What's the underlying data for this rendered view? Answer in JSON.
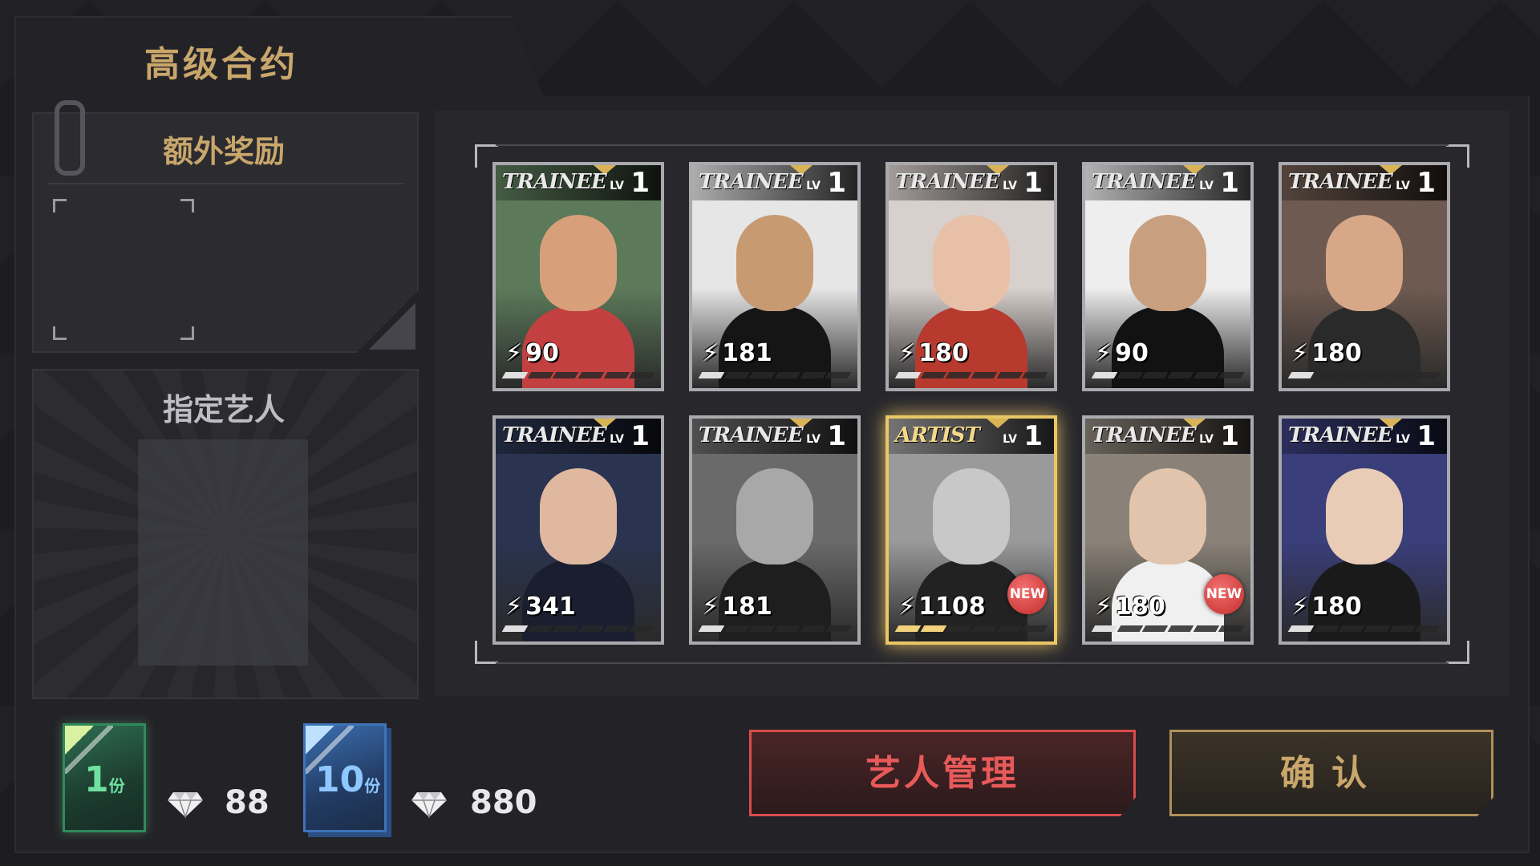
{
  "title": "高级合约",
  "bonus_panel": {
    "title": "额外奖励"
  },
  "artist_panel": {
    "title": "指定艺人"
  },
  "cards": [
    {
      "brand": "TRAINEE",
      "lv_label": "LV",
      "level": "1",
      "power": "90",
      "bars": 1,
      "is_new": false,
      "new_label": "",
      "tier": "silver",
      "colors": [
        "#5c7a5a",
        "#d8a07a",
        "#c34040"
      ]
    },
    {
      "brand": "TRAINEE",
      "lv_label": "LV",
      "level": "1",
      "power": "181",
      "bars": 1,
      "is_new": false,
      "new_label": "",
      "tier": "silver",
      "colors": [
        "#e6e6e6",
        "#c89a72",
        "#151515"
      ]
    },
    {
      "brand": "TRAINEE",
      "lv_label": "LV",
      "level": "1",
      "power": "180",
      "bars": 1,
      "is_new": false,
      "new_label": "",
      "tier": "silver",
      "colors": [
        "#d8d0cc",
        "#e8c0a8",
        "#b83a2e"
      ]
    },
    {
      "brand": "TRAINEE",
      "lv_label": "LV",
      "level": "1",
      "power": "90",
      "bars": 1,
      "is_new": false,
      "new_label": "",
      "tier": "silver",
      "colors": [
        "#eeeeee",
        "#c8a080",
        "#121212"
      ]
    },
    {
      "brand": "TRAINEE",
      "lv_label": "LV",
      "level": "1",
      "power": "180",
      "bars": 1,
      "is_new": false,
      "new_label": "",
      "tier": "silver",
      "colors": [
        "#6e5a50",
        "#d6a888",
        "#2a2a2a"
      ]
    },
    {
      "brand": "TRAINEE",
      "lv_label": "LV",
      "level": "1",
      "power": "341",
      "bars": 1,
      "is_new": false,
      "new_label": "",
      "tier": "silver",
      "colors": [
        "#2a3450",
        "#e0b8a0",
        "#1a1e2e"
      ]
    },
    {
      "brand": "TRAINEE",
      "lv_label": "LV",
      "level": "1",
      "power": "181",
      "bars": 1,
      "is_new": false,
      "new_label": "",
      "tier": "silver",
      "colors": [
        "#6a6a6a",
        "#a8a8a8",
        "#1e1e1e"
      ]
    },
    {
      "brand": "ARTIST",
      "lv_label": "LV",
      "level": "1",
      "power": "1108",
      "bars": 2,
      "is_new": true,
      "new_label": "NEW",
      "tier": "gold",
      "colors": [
        "#9a9a9a",
        "#c8c8c8",
        "#222222"
      ]
    },
    {
      "brand": "TRAINEE",
      "lv_label": "LV",
      "level": "1",
      "power": "180",
      "bars": 1,
      "is_new": true,
      "new_label": "NEW",
      "tier": "silver",
      "colors": [
        "#8a8278",
        "#e2c4ac",
        "#f0f0f0"
      ]
    },
    {
      "brand": "TRAINEE",
      "lv_label": "LV",
      "level": "1",
      "power": "180",
      "bars": 1,
      "is_new": false,
      "new_label": "",
      "tier": "silver",
      "colors": [
        "#3a3e7a",
        "#e8ccb6",
        "#1a1a1a"
      ]
    }
  ],
  "purchase": {
    "single": {
      "count": "1",
      "unit": "份",
      "price": "88"
    },
    "ten": {
      "count": "10",
      "unit": "份",
      "price": "880"
    }
  },
  "buttons": {
    "manage": "艺人管理",
    "confirm": "确认"
  },
  "icons": {
    "currency": "diamond-icon",
    "clip": "paperclip-icon"
  },
  "colors": {
    "gold_text": "#c9a66b",
    "red_button": "#e85a5a",
    "new_badge": "#d63b3b"
  }
}
